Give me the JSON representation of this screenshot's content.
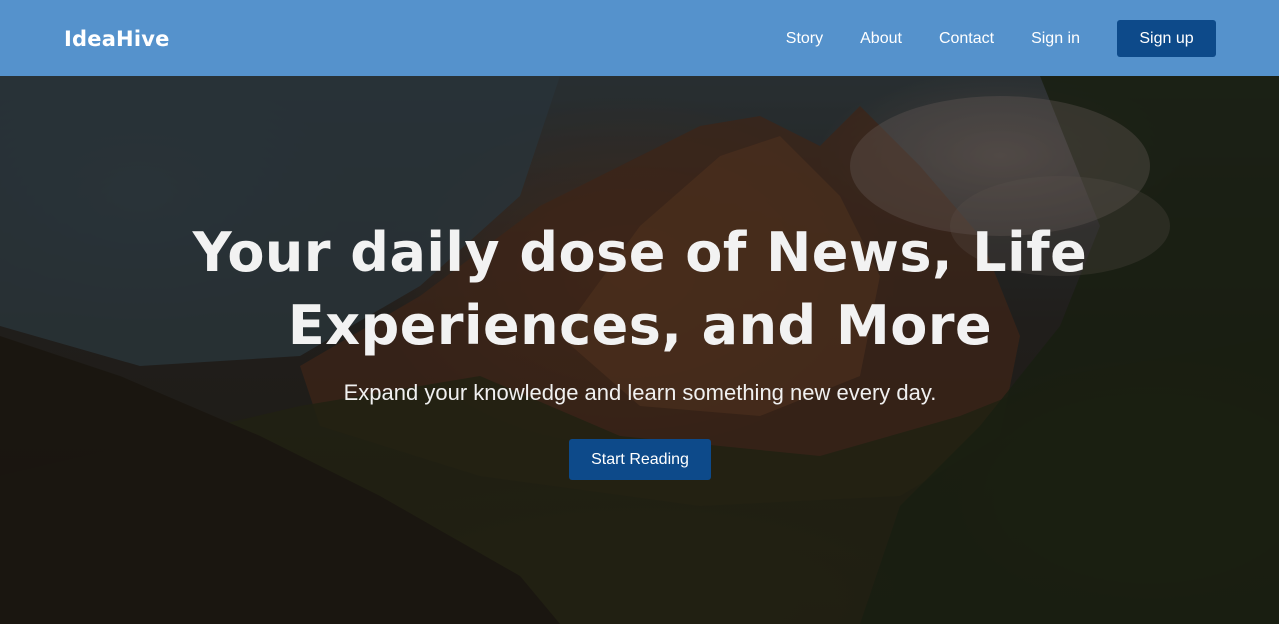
{
  "header": {
    "logo": "IdeaHive",
    "nav": [
      {
        "label": "Story"
      },
      {
        "label": "About"
      },
      {
        "label": "Contact"
      },
      {
        "label": "Sign in"
      }
    ],
    "signup_label": "Sign up"
  },
  "hero": {
    "title_line1": "Your daily dose of News, Life",
    "title_line2": "Experiences, and More",
    "subtitle": "Expand your knowledge and learn something new every day.",
    "cta_label": "Start Reading"
  },
  "colors": {
    "header_bg": "#5592cc",
    "button_bg": "#0d4a8a",
    "text_light": "#f2f2f2"
  }
}
